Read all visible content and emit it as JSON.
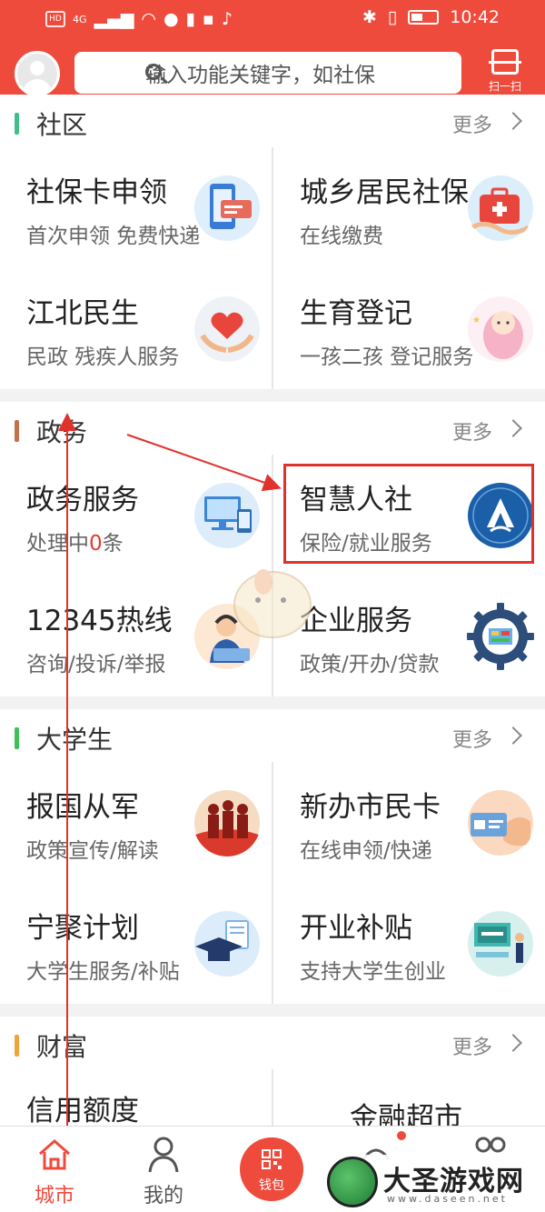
{
  "status_bar": {
    "indicators": [
      "HD",
      "4G"
    ],
    "time": "10:42"
  },
  "header": {
    "search_placeholder": "输入功能关键字，如社保",
    "scan_label": "扫一扫"
  },
  "sections": [
    {
      "title": "社区",
      "more": "更多",
      "accent": "#3fbf8a",
      "items": [
        {
          "name": "社保卡申领",
          "sub": "首次申领 免费快递",
          "icon": "social-card-icon"
        },
        {
          "name": "城乡居民社保",
          "sub": "在线缴费",
          "icon": "medical-kit-icon"
        },
        {
          "name": "江北民生",
          "sub": "民政 残疾人服务",
          "icon": "heart-hands-icon"
        },
        {
          "name": "生育登记",
          "sub": "一孩二孩 登记服务",
          "icon": "baby-icon"
        }
      ]
    },
    {
      "title": "政务",
      "more": "更多",
      "accent": "#c0704a",
      "items": [
        {
          "name": "政务服务",
          "sub_prefix": "处理中",
          "sub_count": "0",
          "sub_suffix": "条",
          "icon": "computer-devices-icon"
        },
        {
          "name": "智慧人社",
          "sub": "保险/就业服务",
          "icon": "hrss-logo-icon"
        },
        {
          "name": "12345热线",
          "sub": "咨询/投诉/举报",
          "icon": "call-center-icon"
        },
        {
          "name": "企业服务",
          "sub": "政策/开办/贷款",
          "icon": "gear-screen-icon"
        }
      ]
    },
    {
      "title": "大学生",
      "more": "更多",
      "accent": "#3fbf55",
      "items": [
        {
          "name": "报国从军",
          "sub": "政策宣传/解读",
          "icon": "soldiers-icon"
        },
        {
          "name": "新办市民卡",
          "sub": "在线申领/快递",
          "icon": "citizen-card-icon"
        },
        {
          "name": "宁聚计划",
          "sub": "大学生服务/补贴",
          "icon": "graduation-cap-icon"
        },
        {
          "name": "开业补贴",
          "sub": "支持大学生创业",
          "icon": "grand-opening-icon"
        }
      ]
    },
    {
      "title": "财富",
      "more": "更多",
      "accent": "#f0a33b",
      "items": [
        {
          "name": "信用额度",
          "sub": "",
          "icon": ""
        },
        {
          "name": "金融超市",
          "sub": "",
          "icon": ""
        }
      ]
    }
  ],
  "tabbar": {
    "tabs": [
      {
        "label": "城市",
        "icon": "home-icon",
        "active": true
      },
      {
        "label": "我的",
        "icon": "person-icon",
        "active": false
      },
      {
        "label": "钱包",
        "icon": "wallet-icon",
        "active": false
      }
    ]
  },
  "watermark": {
    "text": "大圣游戏网",
    "url": "www.daseen.net"
  },
  "colors": {
    "brand": "#ef4b3c",
    "highlight": "#e0322d"
  }
}
